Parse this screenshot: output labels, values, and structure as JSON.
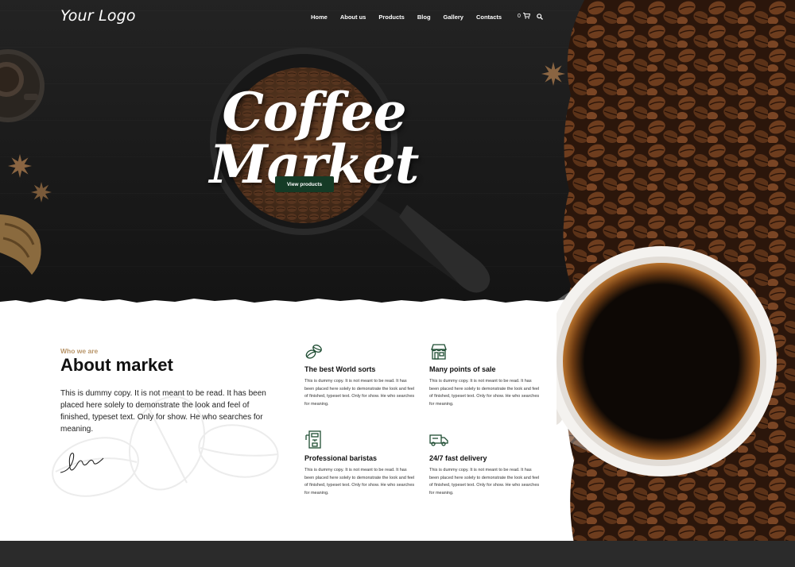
{
  "header": {
    "logo": "Your Logo",
    "nav": [
      "Home",
      "About us",
      "Products",
      "Blog",
      "Gallery",
      "Contacts"
    ],
    "cart_count": "0"
  },
  "hero": {
    "title": "Coffee Market",
    "cta_label": "View products"
  },
  "about": {
    "eyebrow": "Who we are",
    "title": "About market",
    "text": "This is dummy copy. It is not meant to be read. It has been placed here solely to demonstrate the look and feel of finished, typeset text. Only for show. He who searches for meaning."
  },
  "features": [
    {
      "title": "The best World sorts",
      "text": "This is dummy copy. It is not meant to be read. It has been placed here solely to demonstrate the look and feel of finished, typeset text. Only for show. He who searches for meaning.",
      "icon": "coffee-beans-icon"
    },
    {
      "title": "Many points of sale",
      "text": "This is dummy copy. It is not meant to be read. It has been placed here solely to demonstrate the look and feel of finished, typeset text. Only for show. He who searches for meaning.",
      "icon": "shop-icon"
    },
    {
      "title": "Professional baristas",
      "text": "This is dummy copy. It is not meant to be read. It has been placed here solely to demonstrate the look and feel of finished, typeset text. Only for show. He who searches for meaning.",
      "icon": "coffee-machine-icon"
    },
    {
      "title": "24/7 fast delivery",
      "text": "This is dummy copy. It is not meant to be read. It has been placed here solely to demonstrate the look and feel of finished, typeset text. Only for show. He who searches for meaning.",
      "icon": "delivery-truck-icon"
    }
  ],
  "colors": {
    "accent_green": "#153b26",
    "eyebrow_gold": "#b8956a",
    "icon_green": "#1f4d33",
    "hero_bg": "#1b1b1b",
    "footer_bg": "#2b2b2b"
  }
}
